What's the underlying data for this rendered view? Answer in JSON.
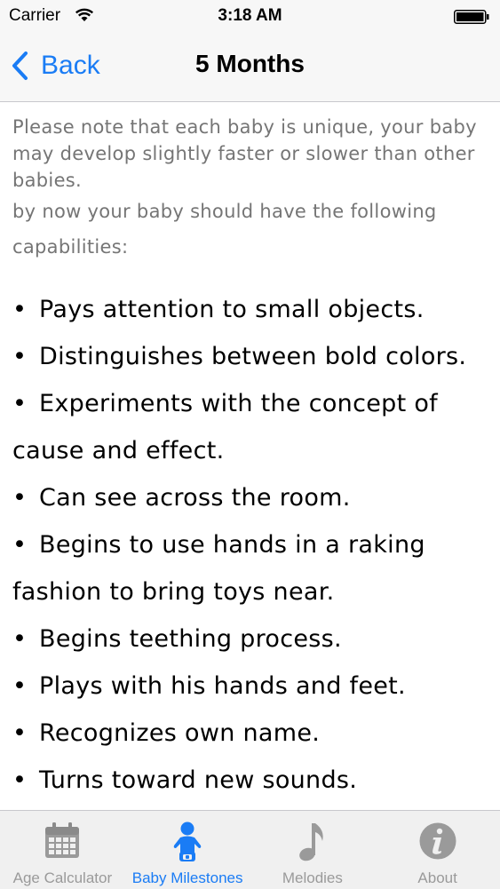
{
  "status_bar": {
    "carrier": "Carrier",
    "time": "3:18 AM"
  },
  "nav": {
    "back_label": "Back",
    "title": "5 Months"
  },
  "intro": {
    "line1": "Please note that each baby is unique, your baby may develop slightly faster or slower than other babies.",
    "line2": "by now your baby should have the following capabilities:"
  },
  "bullet_char": "•",
  "milestones": [
    "Pays attention to small objects.",
    "Distinguishes between bold colors.",
    "Experiments with the concept of cause and effect.",
    "Can see across the room.",
    "Begins to use hands in a raking fashion to bring toys near.",
    "Begins teething process.",
    "Plays with his hands and feet.",
    "Recognizes own name.",
    "Turns toward new sounds."
  ],
  "tabs": [
    {
      "label": "Age Calculator",
      "icon": "calendar-icon",
      "active": false
    },
    {
      "label": "Baby Milestones",
      "icon": "baby-icon",
      "active": true
    },
    {
      "label": "Melodies",
      "icon": "music-note-icon",
      "active": false
    },
    {
      "label": "About",
      "icon": "info-icon",
      "active": false
    }
  ],
  "colors": {
    "accent": "#1a7cf5",
    "inactive": "#9a9a9a",
    "intro_text": "#757575"
  }
}
